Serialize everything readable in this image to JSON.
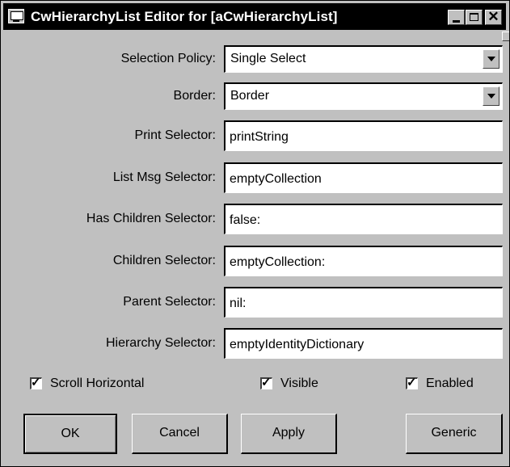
{
  "window": {
    "title": "CwHierarchyList Editor for [aCwHierarchyList]",
    "controls": [
      "minimize",
      "maximize",
      "close"
    ],
    "close_glyph": "✕"
  },
  "form": {
    "selection_policy": {
      "label": "Selection Policy:",
      "value": "Single Select"
    },
    "border": {
      "label": "Border:",
      "value": "Border"
    },
    "print_selector": {
      "label": "Print Selector:",
      "value": "printString"
    },
    "list_msg_selector": {
      "label": "List Msg Selector:",
      "value": "emptyCollection"
    },
    "has_children_selector": {
      "label": "Has Children Selector:",
      "value": "false:"
    },
    "children_selector": {
      "label": "Children Selector:",
      "value": "emptyCollection:"
    },
    "parent_selector": {
      "label": "Parent Selector:",
      "value": "nil:"
    },
    "hierarchy_selector": {
      "label": "Hierarchy Selector:",
      "value": "emptyIdentityDictionary"
    }
  },
  "checkboxes": {
    "scroll_horizontal": {
      "label": "Scroll Horizontal",
      "checked": true
    },
    "visible": {
      "label": "Visible",
      "checked": true
    },
    "enabled": {
      "label": "Enabled",
      "checked": true
    }
  },
  "buttons": {
    "ok": "OK",
    "cancel": "Cancel",
    "apply": "Apply",
    "generic": "Generic"
  },
  "colors": {
    "window_bg": "#c0c0c0",
    "titlebar_bg": "#000000",
    "field_bg": "#ffffff"
  }
}
